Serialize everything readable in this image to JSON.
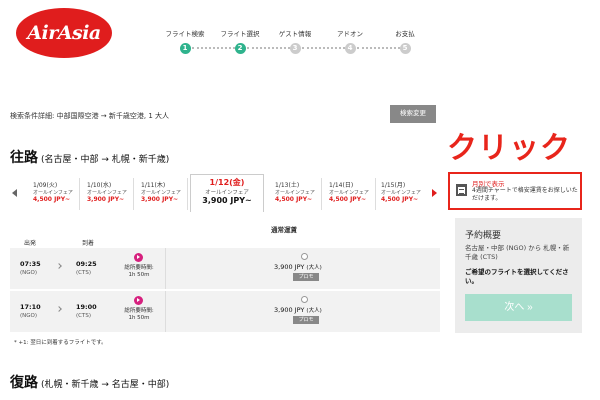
{
  "logo": {
    "text": "AirAsia"
  },
  "steps": [
    {
      "label": "フライト検索",
      "num": "1",
      "done": true
    },
    {
      "label": "フライト選択",
      "num": "2",
      "done": true
    },
    {
      "label": "ゲスト情報",
      "num": "3",
      "done": false
    },
    {
      "label": "アドオン",
      "num": "4",
      "done": false
    },
    {
      "label": "お支払",
      "num": "5",
      "done": false
    }
  ],
  "search": {
    "conditions": "検索条件詳細: 中部国際空港 → 新千歳空港, 1 大人",
    "change_label": "検索変更"
  },
  "annotation": {
    "text": "クリック"
  },
  "outbound": {
    "title": "往路",
    "route": "(名古屋・中部 → 札幌・新千歳)",
    "dates": [
      {
        "date": "1/09(火)",
        "fare": "オールインフェア",
        "price": "4,500 JPY~"
      },
      {
        "date": "1/10(水)",
        "fare": "オールインフェア",
        "price": "3,900 JPY~"
      },
      {
        "date": "1/11(木)",
        "fare": "オールインフェア",
        "price": "3,900 JPY~"
      },
      {
        "date": "1/12(金)",
        "fare": "オールインフェア",
        "price": "3,900 JPY~"
      },
      {
        "date": "1/13(土)",
        "fare": "オールインフェア",
        "price": "4,500 JPY~"
      },
      {
        "date": "1/14(日)",
        "fare": "オールインフェア",
        "price": "4,500 JPY~"
      },
      {
        "date": "1/15(月)",
        "fare": "オールインフェア",
        "price": "4,500 JPY~"
      }
    ],
    "month_view": {
      "title": "月別で表示",
      "desc": "4週間チャートで格安運賃をお探しいただけます。"
    },
    "fare_header": "通常運賃",
    "col_depart": "出発",
    "col_arrive": "到着",
    "flights": [
      {
        "dep_time": "07:35",
        "dep_ap": "(NGO)",
        "arr_time": "09:25",
        "arr_ap": "(CTS)",
        "dur_label": "総所要時間:",
        "dur": "1h 50m",
        "price": "3,900 JPY",
        "unit": "(大人)",
        "promo": "プロモ"
      },
      {
        "dep_time": "17:10",
        "dep_ap": "(NGO)",
        "arr_time": "19:00",
        "arr_ap": "(CTS)",
        "dur_label": "総所要時間:",
        "dur": "1h 50m",
        "price": "3,900 JPY",
        "unit": "(大人)",
        "promo": "プロモ"
      }
    ],
    "note": "* +1: 翌日に到着するフライトです。"
  },
  "summary": {
    "title": "予約概要",
    "route": "名古屋・中部 (NGO) から 札幌・新千歳 (CTS)",
    "prompt": "ご希望のフライトを選択してください。",
    "next_label": "次へ »"
  },
  "return": {
    "title": "復路",
    "route": "(札幌・新千歳 → 名古屋・中部)"
  },
  "colors": {
    "brand": "#e01d1d",
    "accent": "#2fb38d",
    "annotation": "#e8251b",
    "next": "#a8dfcd"
  }
}
